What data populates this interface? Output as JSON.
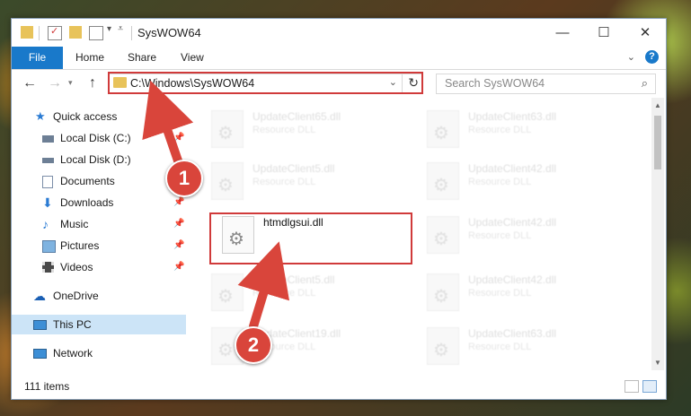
{
  "window": {
    "title": "SysWOW64",
    "controls": {
      "minimize": "—",
      "maximize": "☐",
      "close": "✕"
    }
  },
  "ribbon": {
    "tabs": [
      "File",
      "Home",
      "Share",
      "View"
    ],
    "help": "?"
  },
  "address_bar": {
    "path": "C:\\Windows\\SysWOW64"
  },
  "search": {
    "placeholder": "Search SysWOW64"
  },
  "sidebar": {
    "items": [
      {
        "label": "Quick access",
        "icon": "star-icon"
      },
      {
        "label": "Local Disk (C:)",
        "icon": "drive-icon"
      },
      {
        "label": "Local Disk (D:)",
        "icon": "drive-icon"
      },
      {
        "label": "Documents",
        "icon": "documents-icon"
      },
      {
        "label": "Downloads",
        "icon": "downloads-icon"
      },
      {
        "label": "Music",
        "icon": "music-icon"
      },
      {
        "label": "Pictures",
        "icon": "pictures-icon"
      },
      {
        "label": "Videos",
        "icon": "videos-icon"
      },
      {
        "label": "OneDrive",
        "icon": "onedrive-icon"
      },
      {
        "label": "This PC",
        "icon": "pc-icon"
      },
      {
        "label": "Network",
        "icon": "network-icon"
      }
    ]
  },
  "files": [
    {
      "name": "UpdateClient65.dll",
      "type": "Resource DLL"
    },
    {
      "name": "UpdateClient63.dll",
      "type": "Resource DLL"
    },
    {
      "name": "UpdateClient5.dll",
      "type": "Resource DLL"
    },
    {
      "name": "UpdateClient42.dll",
      "type": "Resource DLL"
    },
    {
      "name": "htmdlgsui.dll",
      "type": ""
    },
    {
      "name": "UpdateClient42.dll",
      "type": "Resource DLL"
    },
    {
      "name": "UpdateClient5.dll",
      "type": "Resource DLL"
    },
    {
      "name": "UpdateClient42.dll",
      "type": "Resource DLL"
    },
    {
      "name": "UpdateClient19.dll",
      "type": "Resource DLL"
    },
    {
      "name": "UpdateClient63.dll",
      "type": "Resource DLL"
    }
  ],
  "status": {
    "item_count": "111 items"
  },
  "callouts": {
    "step1": "1",
    "step2": "2"
  },
  "colors": {
    "accent": "#1979ca",
    "highlight": "#d03a3a",
    "callout": "#d9453b",
    "selected": "#cce4f7"
  }
}
